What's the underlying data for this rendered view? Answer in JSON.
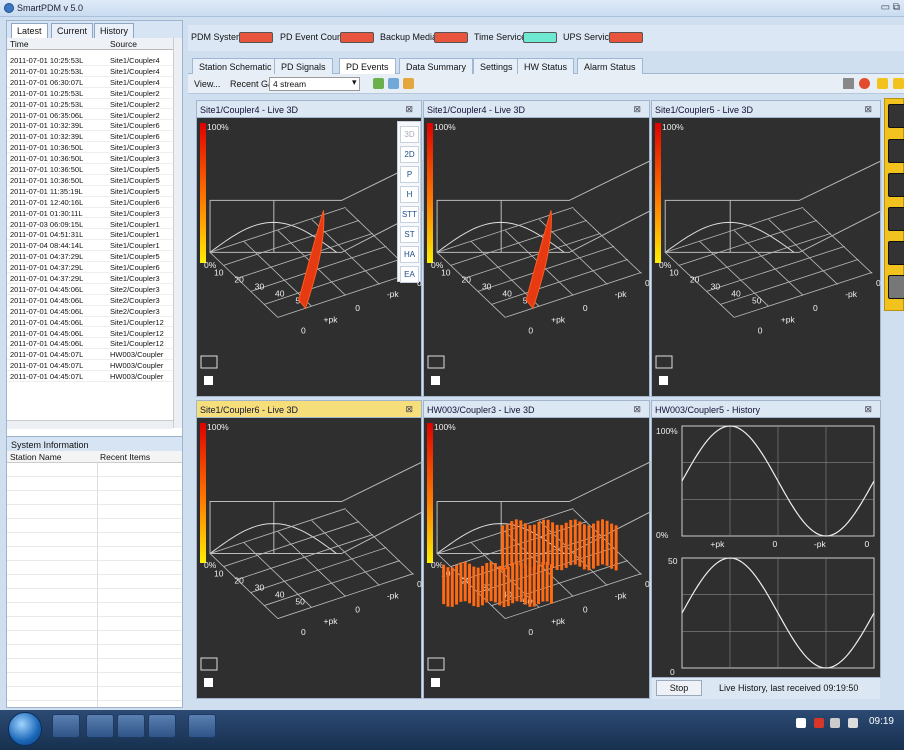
{
  "app": {
    "title": "SmartPDM v 5.0"
  },
  "left": {
    "tabs": [
      "Latest",
      "Current",
      "History"
    ],
    "columns": [
      "Time",
      "Source"
    ],
    "events": [
      [
        "2011-07-01 10:25:53L",
        "Site1/Coupler4"
      ],
      [
        "2011-07-01 10:25:53L",
        "Site1/Coupler4"
      ],
      [
        "2011-07-01 06:30:07L",
        "Site1/Coupler4"
      ],
      [
        "2011-07-01 10:25:53L",
        "Site1/Coupler2"
      ],
      [
        "2011-07-01 10:25:53L",
        "Site1/Coupler2"
      ],
      [
        "2011-07-01 06:35:06L",
        "Site1/Coupler2"
      ],
      [
        "2011-07-01 10:32:39L",
        "Site1/Coupler6"
      ],
      [
        "2011-07-01 10:32:39L",
        "Site1/Coupler6"
      ],
      [
        "2011-07-01 10:36:50L",
        "Site1/Coupler3"
      ],
      [
        "2011-07-01 10:36:50L",
        "Site1/Coupler3"
      ],
      [
        "2011-07-01 10:36:50L",
        "Site1/Coupler5"
      ],
      [
        "2011-07-01 10:36:50L",
        "Site1/Coupler5"
      ],
      [
        "2011-07-01 11:35:19L",
        "Site1/Coupler5"
      ],
      [
        "2011-07-01 12:40:16L",
        "Site1/Coupler6"
      ],
      [
        "2011-07-01 01:30:11L",
        "Site1/Coupler3"
      ],
      [
        "2011-07-03 06:09:15L",
        "Site1/Coupler1"
      ],
      [
        "2011-07-01 04:51:31L",
        "Site1/Coupler1"
      ],
      [
        "2011-07-04 08:44:14L",
        "Site1/Coupler1"
      ],
      [
        "2011-07-01 04:37:29L",
        "Site1/Coupler5"
      ],
      [
        "2011-07-01 04:37:29L",
        "Site1/Coupler6"
      ],
      [
        "2011-07-01 04:37:29L",
        "Site1/Coupler3"
      ],
      [
        "2011-07-01 04:45:06L",
        "Site2/Coupler3"
      ],
      [
        "2011-07-01 04:45:06L",
        "Site2/Coupler3"
      ],
      [
        "2011-07-01 04:45:06L",
        "Site2/Coupler3"
      ],
      [
        "2011-07-01 04:45:06L",
        "Site1/Coupler12"
      ],
      [
        "2011-07-01 04:45:06L",
        "Site1/Coupler12"
      ],
      [
        "2011-07-01 04:45:06L",
        "Site1/Coupler12"
      ],
      [
        "2011-07-01 04:45:07L",
        "HW003/Coupler"
      ],
      [
        "2011-07-01 04:45:07L",
        "HW003/Coupler"
      ],
      [
        "2011-07-01 04:45:07L",
        "HW003/Coupler"
      ]
    ],
    "system": {
      "title": "System Information",
      "columns": [
        "Station Name",
        "Recent Items"
      ]
    }
  },
  "status": {
    "items": [
      "PDM System",
      "PD Event Count",
      "Backup Media",
      "Time Service",
      "UPS Service"
    ],
    "colors": [
      "#e8553c",
      "#e8553c",
      "#e8553c",
      "#6ee8d0",
      "#e8553c"
    ]
  },
  "tabs": [
    "Station Schematic",
    "PD Signals",
    "PD Events",
    "Data Summary",
    "Settings",
    "HW Status",
    "Alarm Status"
  ],
  "toolbar": {
    "view": "View...",
    "galleries_label": "Recent Galleries:",
    "galleries_value": "4 stream"
  },
  "side_buttons": [
    "3D",
    "2D",
    "P",
    "H",
    "STT",
    "ST",
    "HA",
    "EA"
  ],
  "panels": [
    {
      "title": "Site1/Coupler4 - Live 3D",
      "pct_top": "100%",
      "pct_bottom": "0%"
    },
    {
      "title": "Site1/Coupler4 - Live 3D",
      "pct_top": "100%",
      "pct_bottom": "0%"
    },
    {
      "title": "Site1/Coupler5 - Live 3D",
      "pct_top": "100%",
      "pct_bottom": "0%"
    },
    {
      "title": "Site1/Coupler6 - Live 3D",
      "pct_top": "100%",
      "pct_bottom": "0%"
    },
    {
      "title": "HW003/Coupler3 - Live 3D",
      "pct_top": "100%",
      "pct_bottom": "0%"
    },
    {
      "title": "HW003/Coupler5 - History",
      "top_label": "100%",
      "bottom_label": "0%",
      "second_top": "50",
      "second_bottom": "0",
      "x_labels": [
        "+pk",
        "0",
        "-pk",
        "0"
      ]
    }
  ],
  "axis": {
    "depth_ticks": [
      "10",
      "20",
      "30",
      "40",
      "50"
    ],
    "front": [
      "0",
      "+pk",
      "0",
      "-pk"
    ],
    "edge": "0"
  },
  "history": {
    "stop": "Stop",
    "status": "Live History, last received 09:19:50"
  },
  "taskbar": {
    "time": "09:19"
  }
}
